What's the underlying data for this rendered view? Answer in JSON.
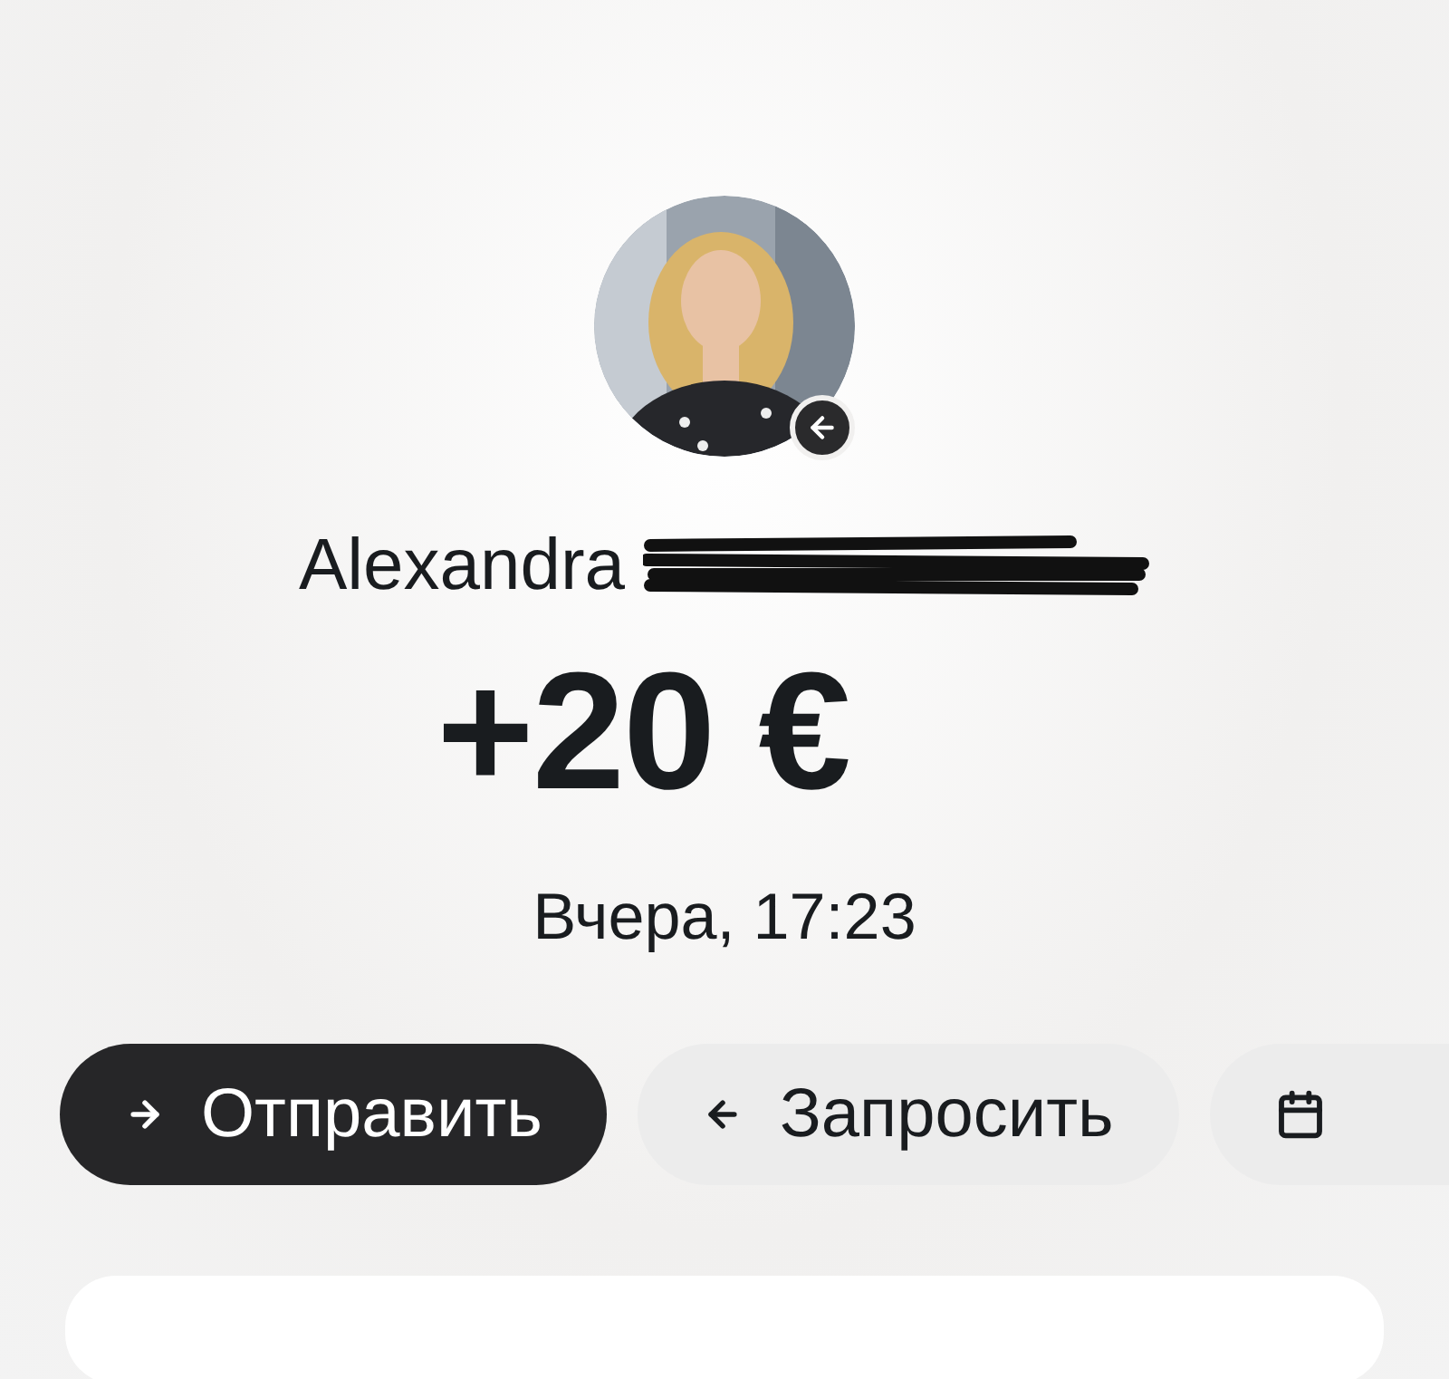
{
  "contact": {
    "name": "Alexandra",
    "surname_redacted": true,
    "incoming": true
  },
  "amount": "+20 €",
  "time": "Вчера, 17:23",
  "actions": [
    {
      "kind": "send",
      "label": "Отправить",
      "selected": true
    },
    {
      "kind": "request",
      "label": "Запросить",
      "selected": false
    },
    {
      "kind": "schedule",
      "selected": false
    }
  ]
}
